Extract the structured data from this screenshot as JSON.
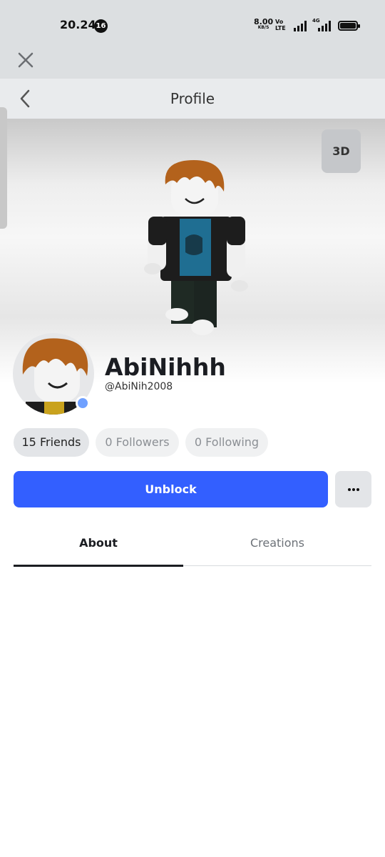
{
  "status_bar": {
    "time": "20.24",
    "notification_count": "16",
    "net_speed": "8.00",
    "net_speed_unit": "KB/S",
    "volte_top": "Vo",
    "volte_bottom": "LTE",
    "network_type": "4G"
  },
  "header": {
    "title": "Profile"
  },
  "stage": {
    "view_toggle_label": "3D"
  },
  "profile": {
    "display_name": "AbiNihhh",
    "username": "@AbiNih2008",
    "online_indicator_color": "#6fa0ff"
  },
  "stats": {
    "friends": "15 Friends",
    "followers": "0 Followers",
    "following": "0 Following"
  },
  "actions": {
    "primary_label": "Unblock",
    "primary_color": "#335fff",
    "more_icon": "ellipsis-icon"
  },
  "tabs": [
    {
      "label": "About",
      "active": true
    },
    {
      "label": "Creations",
      "active": false
    }
  ]
}
